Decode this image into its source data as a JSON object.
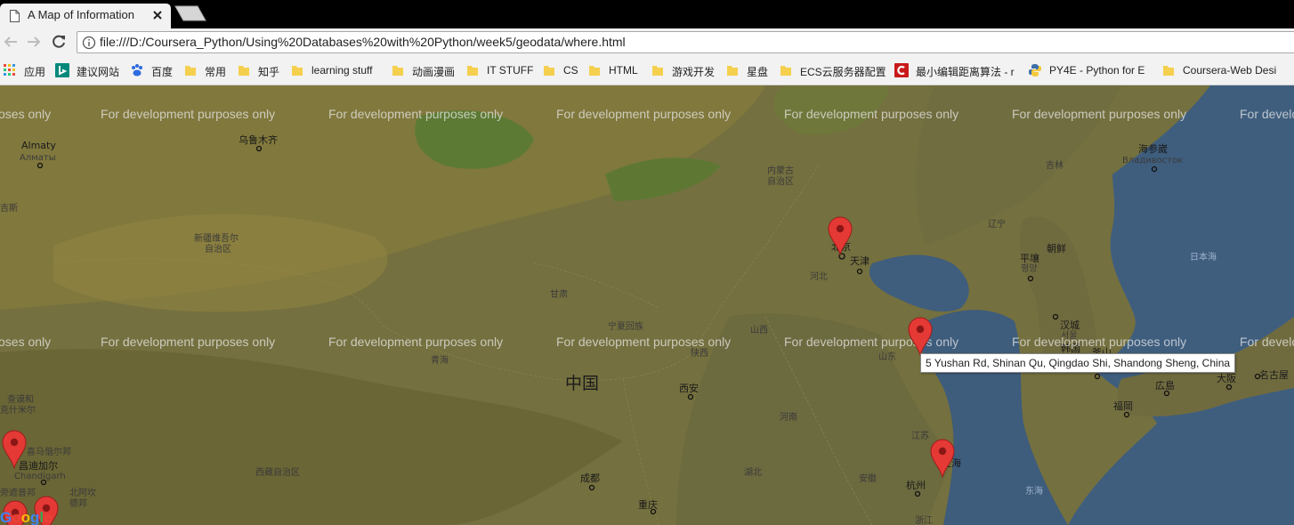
{
  "browser": {
    "tab": {
      "title": "A Map of Information"
    },
    "url": "file:///D:/Coursera_Python/Using%20Databases%20with%20Python/week5/geodata/where.html"
  },
  "bookmarks": [
    {
      "label": "应用",
      "icon": "apps-grid-icon"
    },
    {
      "label": "建议网站",
      "icon": "bing-icon"
    },
    {
      "label": "百度",
      "icon": "baidu-paw-icon"
    },
    {
      "label": "常用",
      "icon": "folder-icon"
    },
    {
      "label": "知乎",
      "icon": "folder-icon"
    },
    {
      "label": "learning stuff",
      "icon": "folder-icon"
    },
    {
      "label": "动画漫画",
      "icon": "folder-icon"
    },
    {
      "label": "IT STUFF",
      "icon": "folder-icon"
    },
    {
      "label": "CS",
      "icon": "folder-icon"
    },
    {
      "label": "HTML",
      "icon": "folder-icon"
    },
    {
      "label": "游戏开发",
      "icon": "folder-icon"
    },
    {
      "label": "星盘",
      "icon": "folder-icon"
    },
    {
      "label": "ECS云服务器配置",
      "icon": "folder-icon"
    },
    {
      "label": "最小编辑距离算法 - r",
      "icon": "csdn-icon"
    },
    {
      "label": "PY4E - Python for E",
      "icon": "python-icon"
    },
    {
      "label": "Coursera-Web Desi",
      "icon": "folder-icon"
    }
  ],
  "map": {
    "watermark": "For development purposes only",
    "watermark_left_fragment": "oses only",
    "watermark_right_fragment": "For develo",
    "tooltip": "5 Yushan Rd, Shinan Qu, Qingdao Shi, Shandong Sheng, China",
    "google_logo": "Google",
    "labels": {
      "almaty": "Almaty",
      "almaty_ru": "Алматы",
      "urumqi": "乌鲁木齐",
      "xinjiang_1": "新疆维吾尔",
      "xinjiang_2": "自治区",
      "inner_mongolia_1": "内蒙古",
      "inner_mongolia_2": "自治区",
      "beijing": "北京",
      "tianjin": "天津",
      "hebei": "河北",
      "gansu": "甘肃",
      "ningxia": "宁夏回族",
      "shanxi": "山西",
      "shaanxi": "陕西",
      "shandong": "山东",
      "qinghai": "青海",
      "china": "中国",
      "xian": "西安",
      "henan": "河南",
      "tibet": "西藏自治区",
      "hubei": "湖北",
      "chengdu": "成都",
      "chongqing": "重庆",
      "anhui": "安徽",
      "jiangsu": "江苏",
      "shanghai": "上海",
      "hangzhou": "杭州",
      "zhejiang": "浙江",
      "jilin": "吉林",
      "liaoning": "辽宁",
      "haishenwai": "海参崴",
      "vladivostok": "Владивосток",
      "north_korea": "朝鲜",
      "pyongyang": "平壤",
      "pyongyang_ko": "평양",
      "seoul": "汉城",
      "seoul_ko": "서울",
      "korea": "韩国",
      "busan": "釜山",
      "sea_of_japan": "日本海",
      "hiroshima": "広島",
      "fukuoka": "福岡",
      "osaka": "大阪",
      "nagoya": "名古屋",
      "east_china_sea": "东海",
      "chandigarh_1": "昌迪加尔",
      "chandigarh_2": "Chandigarh",
      "kashmir_1": "查谟和",
      "kashmir_2": "克什米尔",
      "himachal": "喜马偕尔邦",
      "punjab": "旁遮普邦",
      "uttarakhand_1": "北阿坎",
      "uttarakhand_2": "德邦",
      "kazakh_frag": "吉斯"
    }
  }
}
